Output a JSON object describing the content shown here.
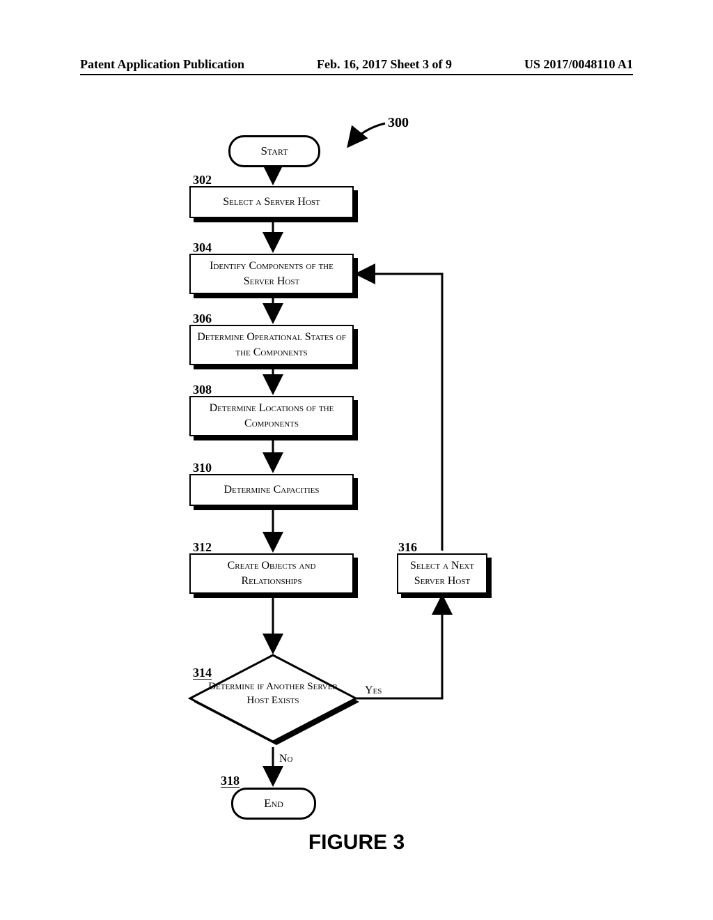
{
  "header": {
    "left": "Patent Application Publication",
    "mid": "Feb. 16, 2017 Sheet 3 of 9",
    "right": "US 2017/0048110 A1"
  },
  "diagram_ref": "300",
  "terminator": {
    "start": "Start",
    "end": "End"
  },
  "steps": {
    "s302": {
      "ref": "302",
      "text": "Select a Server Host"
    },
    "s304": {
      "ref": "304",
      "text": "Identify Components of the Server Host"
    },
    "s306": {
      "ref": "306",
      "text": "Determine Operational States of the Components"
    },
    "s308": {
      "ref": "308",
      "text": "Determine Locations of the Components"
    },
    "s310": {
      "ref": "310",
      "text": "Determine Capacities"
    },
    "s312": {
      "ref": "312",
      "text": "Create Objects and Relationships"
    },
    "s316": {
      "ref": "316",
      "text": "Select a Next Server Host"
    }
  },
  "decision": {
    "ref": "314",
    "text": "Determine if Another Server Host Exists",
    "yes": "Yes",
    "no": "No"
  },
  "end_ref": "318",
  "caption": "FIGURE 3",
  "chart_data": {
    "type": "flowchart",
    "title": "FIGURE 3",
    "ref": "300",
    "nodes": [
      {
        "id": "start",
        "type": "terminator",
        "label": "Start"
      },
      {
        "id": "302",
        "type": "process",
        "label": "Select a Server Host"
      },
      {
        "id": "304",
        "type": "process",
        "label": "Identify Components of the Server Host"
      },
      {
        "id": "306",
        "type": "process",
        "label": "Determine Operational States of the Components"
      },
      {
        "id": "308",
        "type": "process",
        "label": "Determine Locations of the Components"
      },
      {
        "id": "310",
        "type": "process",
        "label": "Determine Capacities"
      },
      {
        "id": "312",
        "type": "process",
        "label": "Create Objects and Relationships"
      },
      {
        "id": "314",
        "type": "decision",
        "label": "Determine if Another Server Host Exists"
      },
      {
        "id": "316",
        "type": "process",
        "label": "Select a Next Server Host"
      },
      {
        "id": "318",
        "type": "terminator",
        "label": "End"
      }
    ],
    "edges": [
      {
        "from": "start",
        "to": "302"
      },
      {
        "from": "302",
        "to": "304"
      },
      {
        "from": "304",
        "to": "306"
      },
      {
        "from": "306",
        "to": "308"
      },
      {
        "from": "308",
        "to": "310"
      },
      {
        "from": "310",
        "to": "312"
      },
      {
        "from": "312",
        "to": "314"
      },
      {
        "from": "314",
        "to": "316",
        "label": "Yes"
      },
      {
        "from": "316",
        "to": "304"
      },
      {
        "from": "314",
        "to": "318",
        "label": "No"
      }
    ]
  }
}
